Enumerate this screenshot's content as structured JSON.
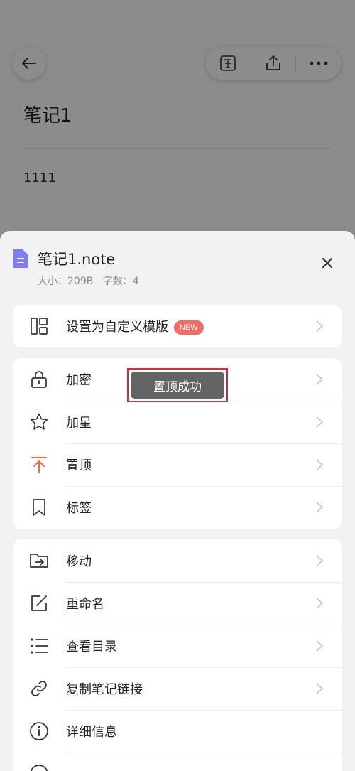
{
  "note_page": {
    "title": "笔记1",
    "body": "1111"
  },
  "sheet": {
    "file_name": "笔记1.note",
    "file_meta": "大小：209B   字数：4",
    "template_card": {
      "label": "设置为自定义模版",
      "badge": "NEW"
    },
    "group1": [
      {
        "label": "加密",
        "icon": "lock-icon"
      },
      {
        "label": "加星",
        "icon": "star-icon"
      },
      {
        "label": "置顶",
        "icon": "pin-top-icon"
      },
      {
        "label": "标签",
        "icon": "bookmark-icon"
      }
    ],
    "group2": [
      {
        "label": "移动",
        "icon": "move-folder-icon"
      },
      {
        "label": "重命名",
        "icon": "rename-icon"
      },
      {
        "label": "查看目录",
        "icon": "list-icon"
      },
      {
        "label": "复制笔记链接",
        "icon": "link-icon"
      },
      {
        "label": "详细信息",
        "icon": "info-icon"
      }
    ]
  },
  "toast": {
    "text": "置顶成功"
  },
  "colors": {
    "accent_orange": "#f06a4a",
    "badge_red": "#ee6d64",
    "file_icon_purple": "#7e7ef0",
    "toast_frame": "#c9303b"
  }
}
